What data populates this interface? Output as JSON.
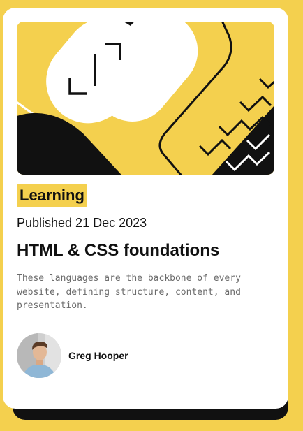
{
  "card": {
    "hero_image": "abstract-yellow-black-white-illustration",
    "category": "Learning",
    "published": "Published 21 Dec 2023",
    "title": "HTML & CSS foundations",
    "description": "These languages are the backbone of every website, defining structure, content, and presentation.",
    "author": {
      "name": "Greg Hooper",
      "avatar": "person-avatar-photo"
    }
  },
  "colors": {
    "background": "#F4D04E",
    "card": "#FFFFFF",
    "shadow": "#111111",
    "text": "#111111",
    "muted_text": "#6B6B6B"
  }
}
